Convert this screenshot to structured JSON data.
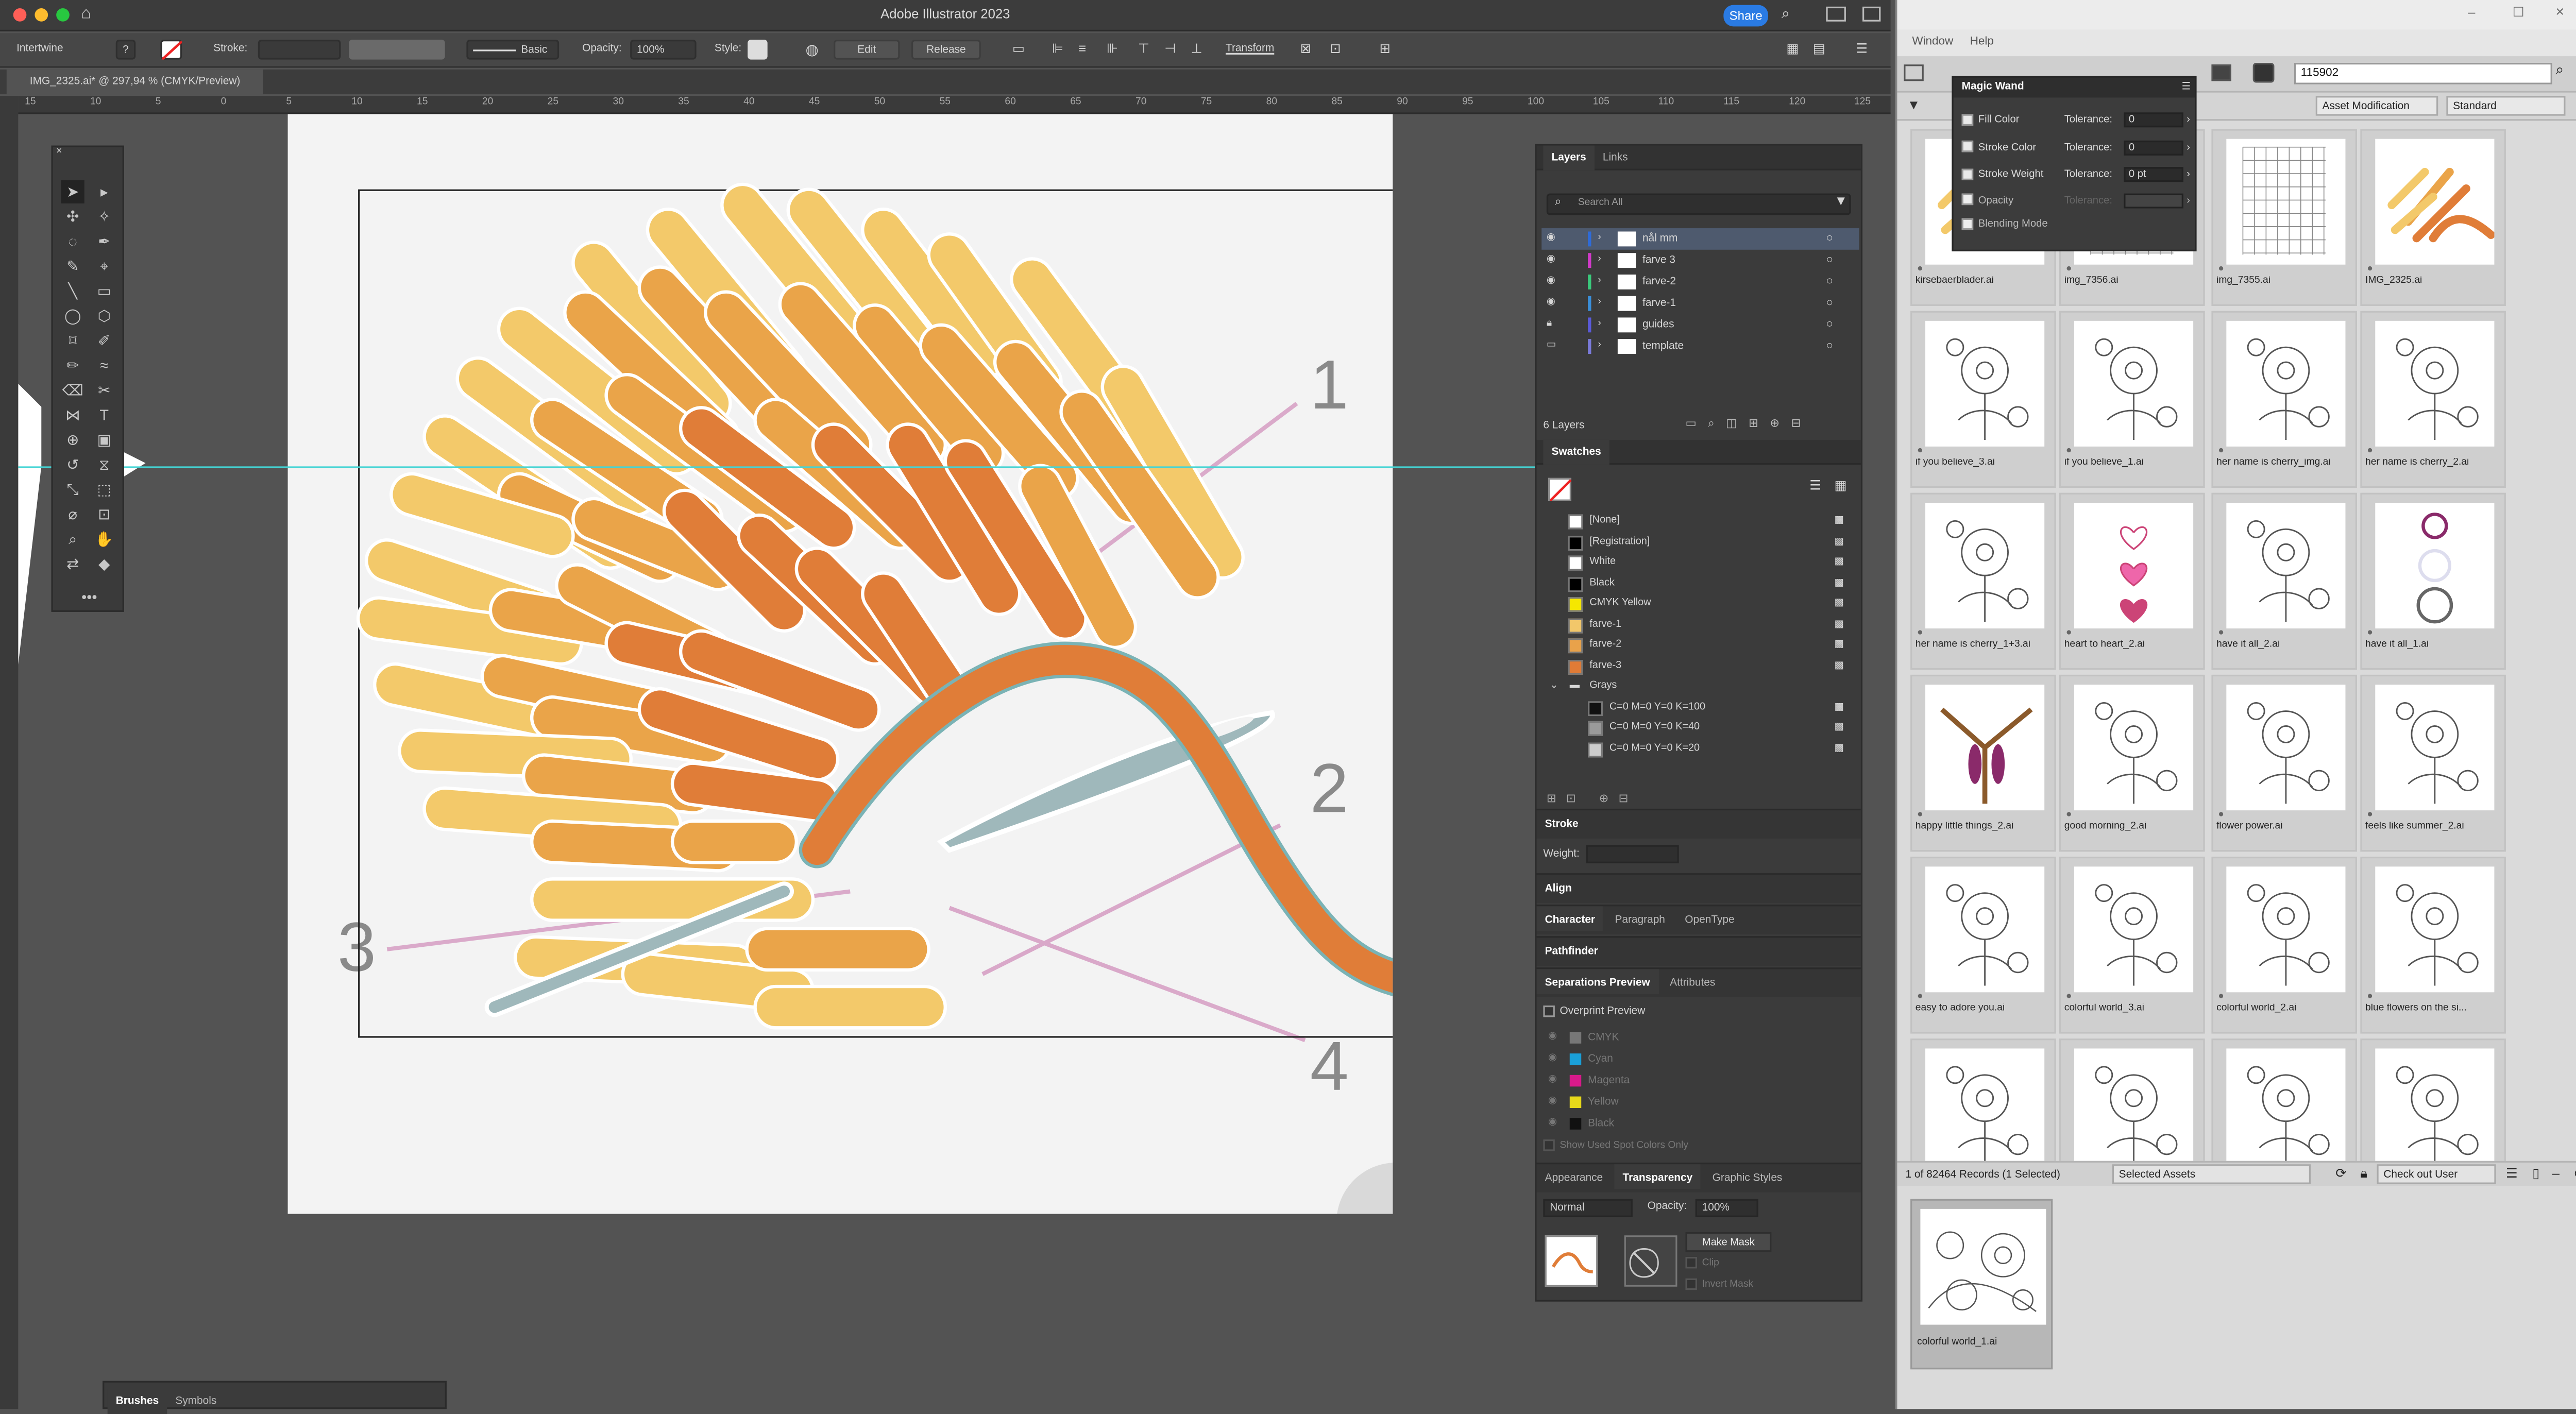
{
  "app": {
    "title": "Adobe Illustrator 2023",
    "share": "Share"
  },
  "control": {
    "selection": "Intertwine",
    "stroke_label": "Stroke:",
    "brush": "Basic",
    "opacity_label": "Opacity:",
    "opacity": "100%",
    "style_label": "Style:",
    "edit": "Edit",
    "release": "Release",
    "transform": "Transform"
  },
  "doc": {
    "tab": "IMG_2325.ai* @ 297,94 % (CMYK/Preview)"
  },
  "ruler": [
    "15",
    "10",
    "5",
    "0",
    "5",
    "10",
    "15",
    "20",
    "25",
    "30",
    "35",
    "40",
    "45",
    "50",
    "55",
    "60",
    "65",
    "70",
    "75",
    "80",
    "85",
    "90",
    "95",
    "100",
    "105",
    "110",
    "115",
    "120",
    "125"
  ],
  "canvas": {
    "labels": [
      "1",
      "2",
      "3",
      "4"
    ]
  },
  "layers": {
    "tabs": [
      "Layers",
      "Links"
    ],
    "search_placeholder": "Search All",
    "items": [
      "nål mm",
      "farve 3",
      "farve-2",
      "farve-1",
      "guides",
      "template"
    ],
    "colors": [
      "#2e6bd8",
      "#d03ac8",
      "#3ac87b",
      "#3a8ed8",
      "#5a5ad8",
      "#7a7ad8"
    ],
    "count": "6 Layers"
  },
  "swatches": {
    "title": "Swatches",
    "items": [
      {
        "name": "[None]",
        "color": "#ffffff"
      },
      {
        "name": "[Registration]",
        "color": "#000000"
      },
      {
        "name": "White",
        "color": "#ffffff"
      },
      {
        "name": "Black",
        "color": "#000000"
      },
      {
        "name": "CMYK Yellow",
        "color": "#f5e700"
      },
      {
        "name": "farve-1",
        "color": "#f2c76a"
      },
      {
        "name": "farve-2",
        "color": "#e9a24a"
      },
      {
        "name": "farve-3",
        "color": "#e07b36"
      }
    ],
    "group": "Grays",
    "grays": [
      {
        "name": "C=0 M=0 Y=0 K=100",
        "color": "#111111"
      },
      {
        "name": "C=0 M=0 Y=0 K=40",
        "color": "#9a9a9a"
      },
      {
        "name": "C=0 M=0 Y=0 K=20",
        "color": "#cccccc"
      }
    ]
  },
  "stroke": {
    "title": "Stroke",
    "weight_label": "Weight:"
  },
  "align": {
    "title": "Align"
  },
  "character": {
    "tabs": [
      "Character",
      "Paragraph",
      "OpenType"
    ]
  },
  "pathfinder": {
    "title": "Pathfinder"
  },
  "separations": {
    "tabs": [
      "Separations Preview",
      "Attributes"
    ],
    "overprint": "Overprint Preview",
    "plates": [
      {
        "name": "CMYK",
        "color": "#777777"
      },
      {
        "name": "Cyan",
        "color": "#1aa0d8"
      },
      {
        "name": "Magenta",
        "color": "#d81a8a"
      },
      {
        "name": "Yellow",
        "color": "#e6d81a"
      },
      {
        "name": "Black",
        "color": "#111111"
      }
    ],
    "spot": "Show Used Spot Colors Only"
  },
  "transparency": {
    "tabs": [
      "Appearance",
      "Transparency",
      "Graphic Styles"
    ],
    "mode": "Normal",
    "opacity_label": "Opacity:",
    "opacity": "100%",
    "make_mask": "Make Mask",
    "clip": "Clip",
    "invert": "Invert Mask"
  },
  "bridge": {
    "menu": [
      "Window",
      "Help"
    ],
    "search": "115902",
    "filter_a": "Asset Modification",
    "filter_b": "Standard",
    "status": "1 of 82464 Records (1 Selected)",
    "selected_assets": "Selected Assets",
    "checkout": "Check out User",
    "thumbs": [
      "kirsebaerblader.ai",
      "img_7356.ai",
      "img_7355.ai",
      "IMG_2325.ai",
      "if you believe_3.ai",
      "if you believe_1.ai",
      "her name is cherry_img.ai",
      "her name is cherry_2.ai",
      "her name is cherry_1+3.ai",
      "heart to heart_2.ai",
      "have it all_2.ai",
      "have it all_1.ai",
      "happy little things_2.ai",
      "good morning_2.ai",
      "flower power.ai",
      "feels like summer_2.ai",
      "easy to adore you.ai",
      "colorful world_3.ai",
      "colorful world_2.ai",
      "blue flowers on the si...",
      "",
      "",
      "",
      ""
    ],
    "selected": "colorful world_1.ai"
  },
  "magic_wand": {
    "title": "Magic Wand",
    "rows": [
      {
        "label": "Fill Color",
        "tol": "0"
      },
      {
        "label": "Stroke Color",
        "tol": "0"
      },
      {
        "label": "Stroke Weight",
        "tol": "0 pt"
      },
      {
        "label": "Opacity",
        "tol": ""
      },
      {
        "label": "Blending Mode",
        "tol": ""
      }
    ],
    "tol_label": "Tolerance:"
  },
  "bottom_panel": {
    "tabs": [
      "Brushes",
      "Symbols"
    ]
  }
}
